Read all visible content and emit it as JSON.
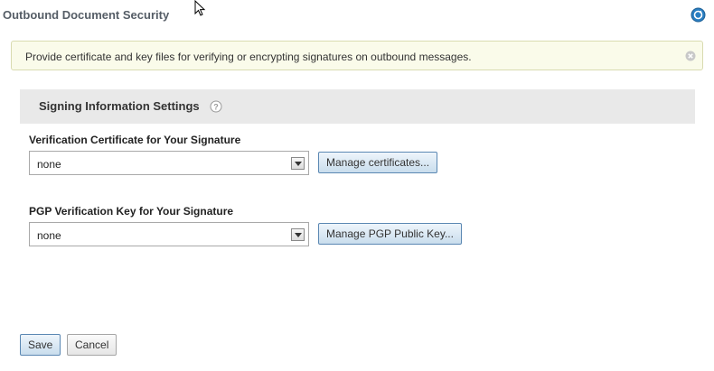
{
  "page": {
    "title": "Outbound Document Security",
    "refresh_icon": "refresh-icon"
  },
  "banner": {
    "text": "Provide certificate and key files for verifying or encrypting signatures on outbound messages.",
    "close_icon": "close-icon"
  },
  "section": {
    "title": "Signing Information Settings",
    "help_icon": "help-icon"
  },
  "fields": {
    "certificate": {
      "label": "Verification Certificate for Your Signature",
      "value": "none",
      "button_label": "Manage certificates..."
    },
    "pgp_key": {
      "label": "PGP Verification Key for Your Signature",
      "value": "none",
      "button_label": "Manage PGP Public Key..."
    }
  },
  "footer": {
    "save_label": "Save",
    "cancel_label": "Cancel"
  },
  "colors": {
    "accent_blue": "#2a7ec1",
    "banner_bg": "#fafbea",
    "section_bg": "#e9e9e9"
  }
}
